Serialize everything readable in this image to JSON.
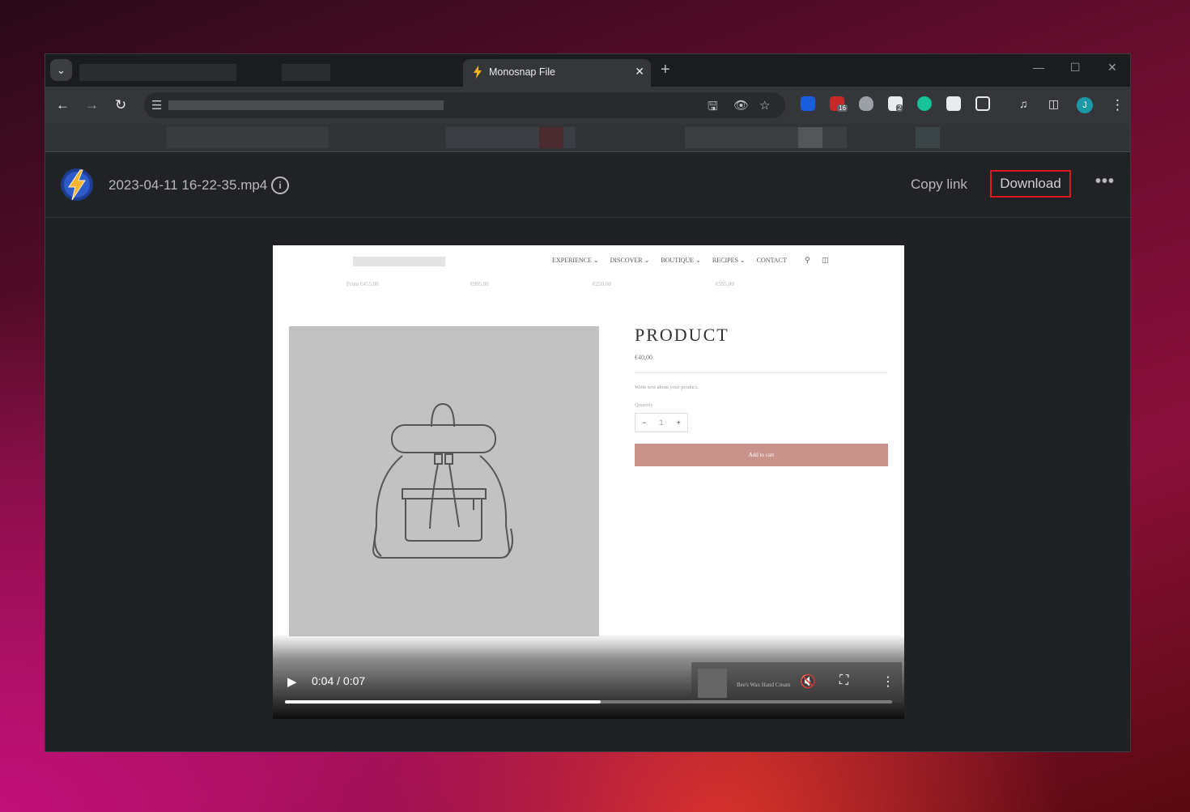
{
  "browser": {
    "active_tab_title": "Monosnap File",
    "new_tab_symbol": "+",
    "close_symbol": "✕",
    "extension_badges": [
      "16",
      "2"
    ],
    "profile_initial": "J"
  },
  "monosnap": {
    "filename": "2023-04-11 16-22-35.mp4",
    "info_symbol": "i",
    "copy_link_label": "Copy link",
    "download_label": "Download",
    "more_symbol": "•••",
    "highlight_color": "#e0161f"
  },
  "video": {
    "time_display": "0:04 / 0:07",
    "progress_fraction": 0.52,
    "site": {
      "nav": [
        "EXPERIENCE ⌄",
        "DISCOVER ⌄",
        "BOUTIQUE ⌄",
        "RECIPES ⌄",
        "CONTACT"
      ],
      "prices": [
        "From €455,00",
        "€995,00",
        "€250,00",
        "€595,00"
      ],
      "product_title": "PRODUCT",
      "product_price": "€40,00",
      "product_desc": "Write text about your product.",
      "quantity_label": "Quantity",
      "quantity_minus": "−",
      "quantity_value": "1",
      "quantity_plus": "+",
      "add_to_cart": "Add to cart",
      "sticky_product_name": "Bee's Wax Hand Cream",
      "accent_color": "#c9938b"
    }
  }
}
